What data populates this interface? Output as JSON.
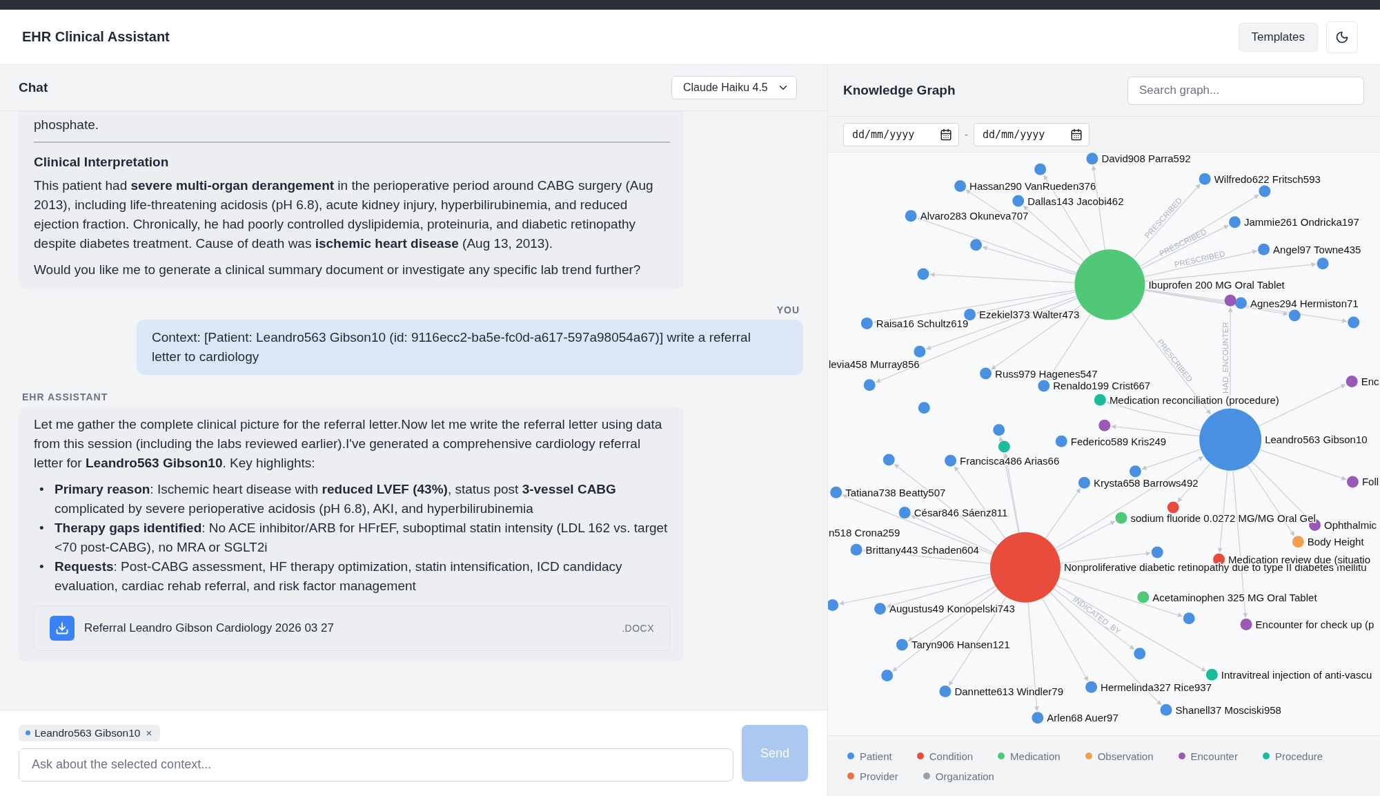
{
  "app": {
    "title": "EHR Clinical Assistant",
    "templates_button": "Templates"
  },
  "chat": {
    "title": "Chat",
    "model": "Claude Haiku 4.5",
    "messages": [
      {
        "kind": "assistant",
        "blocks": [
          {
            "kind": "paragraph",
            "text": "phosphate."
          },
          {
            "kind": "rule"
          },
          {
            "kind": "heading",
            "text": "Clinical Interpretation"
          },
          {
            "kind": "paragraph",
            "text": "This patient had **severe multi-organ derangement** in the perioperative period around CABG surgery (Aug 2013), including life-threatening acidosis (pH 6.8), acute kidney injury, hyperbilirubinemia, and reduced ejection fraction. Chronically, he had poorly controlled dyslipidemia, proteinuria, and diabetic retinopathy despite diabetes treatment. Cause of death was **ischemic heart disease** (Aug 13, 2013)."
          },
          {
            "kind": "paragraph",
            "text": "Would you like me to generate a clinical summary document or investigate any specific lab trend further?"
          }
        ]
      },
      {
        "kind": "user",
        "sender": "YOU",
        "blocks": [
          {
            "kind": "paragraph",
            "text": "Context: [Patient: Leandro563 Gibson10 (id: 9116ecc2-ba5e-fc0d-a617-597a98054a67)] write a referral letter to cardiology"
          }
        ]
      },
      {
        "kind": "assistant",
        "sender": "EHR ASSISTANT",
        "blocks": [
          {
            "kind": "paragraph",
            "text": "Let me gather the complete clinical picture for the referral letter.Now let me write the referral letter using data from this session (including the labs reviewed earlier).I've generated a comprehensive cardiology referral letter for **Leandro563 Gibson10**. Key highlights:"
          },
          {
            "kind": "list",
            "items": [
              {
                "bullet": "•",
                "text": "**Primary reason**: Ischemic heart disease with **reduced LVEF (43%)**, status post **3-vessel CABG** complicated by severe perioperative acidosis (pH 6.8), AKI, and hyperbilirubinemia"
              },
              {
                "bullet": "•",
                "text": "**Therapy gaps identified**: No ACE inhibitor/ARB for HFrEF, suboptimal statin intensity (LDL 162 vs. target <70 post-CABG), no MRA or SGLT2i"
              },
              {
                "bullet": "•",
                "text": "**Requests**: Post-CABG assessment, HF therapy optimization, statin intensification, ICD candidacy evaluation, cardiac rehab referral, and risk factor management"
              }
            ]
          },
          {
            "kind": "attachment",
            "name": "Referral Leandro Gibson Cardiology 2026 03 27",
            "ext": ".DOCX"
          }
        ]
      }
    ],
    "context_chip": {
      "label": "Leandro563 Gibson10",
      "remove": "×"
    },
    "input": {
      "placeholder": "Ask about the selected context..."
    },
    "send_button": {
      "label": "Send",
      "disabled": true
    }
  },
  "graph": {
    "title": "Knowledge Graph",
    "search": {
      "placeholder": "Search graph..."
    },
    "date_filter": {
      "from_placeholder": "dd/mm/yyyy",
      "separator": "-",
      "to_placeholder": "dd/mm/yyyy"
    },
    "nodes": [
      {
        "kind": "medication",
        "label": "Ibuprofen 200 MG Oral Tablet"
      },
      {
        "kind": "patient",
        "label": "Leandro563 Gibson10"
      },
      {
        "kind": "condition",
        "label": "Nonproliferative diabetic retinopathy due to type II diabetes mellitu"
      },
      {
        "kind": "patient",
        "label": "David908 Parra592"
      },
      {
        "kind": "patient",
        "label": "Hassan290 VanRueden376"
      },
      {
        "kind": "patient",
        "label": "Dallas143 Jacobi462"
      },
      {
        "kind": "patient"
      },
      {
        "kind": "patient",
        "label": "Alvaro283 Okuneva707"
      },
      {
        "kind": "patient"
      },
      {
        "kind": "patient"
      },
      {
        "kind": "patient",
        "label": "Wilfredo622 Fritsch593"
      },
      {
        "kind": "patient"
      },
      {
        "kind": "patient",
        "label": "Jammie261 Ondricka197"
      },
      {
        "kind": "patient",
        "label": "Angel97 Towne435"
      },
      {
        "kind": "patient"
      },
      {
        "kind": "patient",
        "label": "Raisa16 Schultz619"
      },
      {
        "kind": "patient",
        "label": "Ezekiel373 Walter473"
      },
      {
        "kind": "patient"
      },
      {
        "label": "levia458 Murray856"
      },
      {
        "kind": "patient"
      },
      {
        "kind": "patient",
        "label": "Russ979 Hagenes547"
      },
      {
        "kind": "patient",
        "label": "Renaldo199 Crist667"
      },
      {
        "kind": "patient",
        "label": "Agnes294 Hermiston71"
      },
      {
        "kind": "encounter"
      },
      {
        "kind": "patient"
      },
      {
        "kind": "patient"
      },
      {
        "kind": "encounter",
        "label": "Enc"
      },
      {
        "kind": "procedure",
        "label": "Medication reconciliation (procedure)"
      },
      {
        "kind": "encounter"
      },
      {
        "kind": "patient",
        "label": "Federico589 Kris249"
      },
      {
        "kind": "procedure"
      },
      {
        "kind": "patient"
      },
      {
        "kind": "patient"
      },
      {
        "kind": "patient"
      },
      {
        "kind": "patient",
        "label": "Francisca486 Arias66"
      },
      {
        "kind": "patient",
        "label": "Krysta658 Barrows492"
      },
      {
        "kind": "patient"
      },
      {
        "kind": "encounter",
        "label": "Foll"
      },
      {
        "kind": "patient",
        "label": "Tatiana738 Beatty507"
      },
      {
        "kind": "patient",
        "label": "César846 Sáenz811"
      },
      {
        "kind": "medication",
        "label": "sodium fluoride 0.0272 MG/MG Oral Gel"
      },
      {
        "kind": "condition"
      },
      {
        "kind": "encounter",
        "label": "Ophthalmic"
      },
      {
        "label": "n518 Crona259"
      },
      {
        "kind": "patient",
        "label": "Brittany443 Schaden604"
      },
      {
        "kind": "patient"
      },
      {
        "kind": "observation",
        "label": "Body Height"
      },
      {
        "kind": "condition",
        "label": "Medication review due (situatio"
      },
      {
        "kind": "patient"
      },
      {
        "kind": "patient",
        "label": "Augustus49 Konopelski743"
      },
      {
        "kind": "medication",
        "label": "Acetaminophen 325 MG Oral Tablet"
      },
      {
        "kind": "patient"
      },
      {
        "kind": "encounter",
        "label": "Encounter for check up (p"
      },
      {
        "kind": "patient",
        "label": "Taryn906 Hansen121"
      },
      {
        "kind": "patient"
      },
      {
        "kind": "patient"
      },
      {
        "kind": "procedure",
        "label": "Intravitreal injection of anti-vascu"
      },
      {
        "kind": "patient",
        "label": "Dannette613 Windler79"
      },
      {
        "kind": "patient",
        "label": "Hermelinda327 Rice937"
      },
      {
        "kind": "patient",
        "label": "Shanell37 Mosciski958"
      },
      {
        "kind": "patient",
        "label": "Arlen68 Auer97"
      }
    ],
    "edge_labels": [
      "PRESCRIBED",
      "PRESCRIBED",
      "PRESCRIBED",
      "PRESCRIBED",
      "HAD_ENCOUNTER",
      "INDICATED_BY"
    ],
    "legend": [
      {
        "label": "Patient",
        "color": "#4a90e2"
      },
      {
        "label": "Condition",
        "color": "#e74c3c"
      },
      {
        "label": "Medication",
        "color": "#50c878"
      },
      {
        "label": "Observation",
        "color": "#f0a050"
      },
      {
        "label": "Encounter",
        "color": "#9b59b6"
      },
      {
        "label": "Procedure",
        "color": "#1abc9c"
      },
      {
        "label": "Provider",
        "color": "#f07040"
      },
      {
        "label": "Organization",
        "color": "#9aa0a6"
      }
    ]
  }
}
